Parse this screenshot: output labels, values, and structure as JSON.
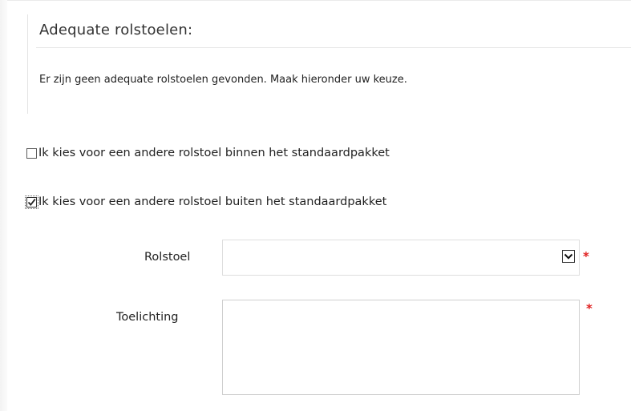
{
  "panel": {
    "title": "Adequate rolstoelen:",
    "message": "Er zijn geen adequate rolstoelen gevonden. Maak hieronder uw keuze."
  },
  "options": [
    {
      "label": "Ik kies voor een andere rolstoel binnen het standaardpakket",
      "checked": false
    },
    {
      "label": "Ik kies voor een andere rolstoel buiten het standaardpakket",
      "checked": true
    }
  ],
  "form": {
    "rolstoel_label": "Rolstoel",
    "rolstoel_value": "",
    "toelichting_label": "Toelichting",
    "toelichting_value": "",
    "required_marker": "*"
  },
  "colors": {
    "required": "#e02020",
    "border": "#dedede",
    "text": "#222222"
  },
  "icons": {
    "dropdown": "chevron-down-icon",
    "check": "checkmark-icon"
  }
}
